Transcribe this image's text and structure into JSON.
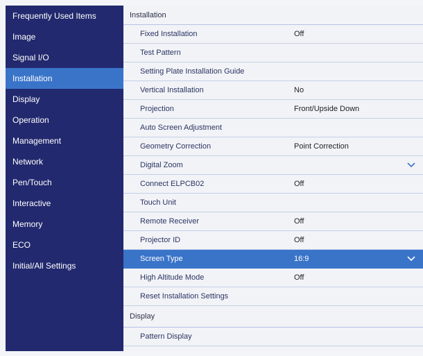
{
  "sidebar": {
    "items": [
      {
        "label": "Frequently Used Items"
      },
      {
        "label": "Image"
      },
      {
        "label": "Signal I/O"
      },
      {
        "label": "Installation"
      },
      {
        "label": "Display"
      },
      {
        "label": "Operation"
      },
      {
        "label": "Management"
      },
      {
        "label": "Network"
      },
      {
        "label": "Pen/Touch"
      },
      {
        "label": "Interactive"
      },
      {
        "label": "Memory"
      },
      {
        "label": "ECO"
      },
      {
        "label": "Initial/All Settings"
      }
    ],
    "selected_index": 3
  },
  "main": {
    "installation_header": "Installation",
    "installation_rows": [
      {
        "label": "Fixed Installation",
        "value": "Off"
      },
      {
        "label": "Test Pattern",
        "value": ""
      },
      {
        "label": "Setting Plate Installation Guide",
        "value": ""
      },
      {
        "label": "Vertical Installation",
        "value": "No"
      },
      {
        "label": "Projection",
        "value": "Front/Upside Down"
      },
      {
        "label": "Auto Screen Adjustment",
        "value": ""
      },
      {
        "label": "Geometry Correction",
        "value": "Point Correction"
      },
      {
        "label": "Digital Zoom",
        "value": "",
        "expand": true
      },
      {
        "label": "Connect ELPCB02",
        "value": "Off"
      },
      {
        "label": "Touch Unit",
        "value": ""
      },
      {
        "label": "Remote Receiver",
        "value": "Off"
      },
      {
        "label": "Projector ID",
        "value": "Off"
      },
      {
        "label": "Screen Type",
        "value": "16:9",
        "expand": true,
        "selected": true
      },
      {
        "label": "High Altitude Mode",
        "value": "Off"
      },
      {
        "label": "Reset Installation Settings",
        "value": ""
      }
    ],
    "display_header": "Display",
    "display_rows": [
      {
        "label": "Pattern Display",
        "value": ""
      }
    ]
  },
  "colors": {
    "sidebar_bg": "#22296e",
    "selection": "#3a74c9",
    "content_bg": "#f2f3f7",
    "row_text": "#2a3562"
  },
  "icons": {
    "expand": "chevron-down-icon"
  }
}
